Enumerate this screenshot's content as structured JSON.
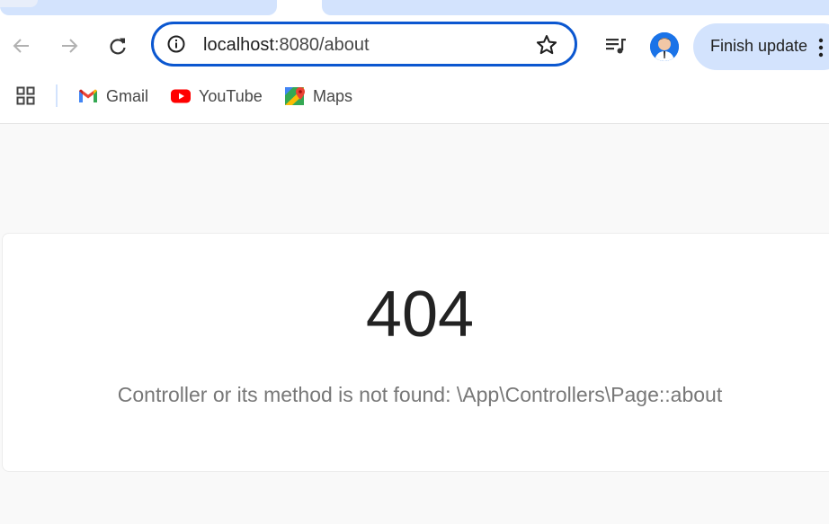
{
  "browser": {
    "url_host": "localhost",
    "url_path": ":8080/about",
    "update_label": "Finish update",
    "colors": {
      "accent": "#0b57d0",
      "tab": "#d3e3fd"
    }
  },
  "bookmarks": [
    {
      "label": "Gmail",
      "icon": "gmail-icon"
    },
    {
      "label": "YouTube",
      "icon": "youtube-icon"
    },
    {
      "label": "Maps",
      "icon": "maps-icon"
    }
  ],
  "page": {
    "code": "404",
    "message": "Controller or its method is not found: \\App\\Controllers\\Page::about"
  }
}
